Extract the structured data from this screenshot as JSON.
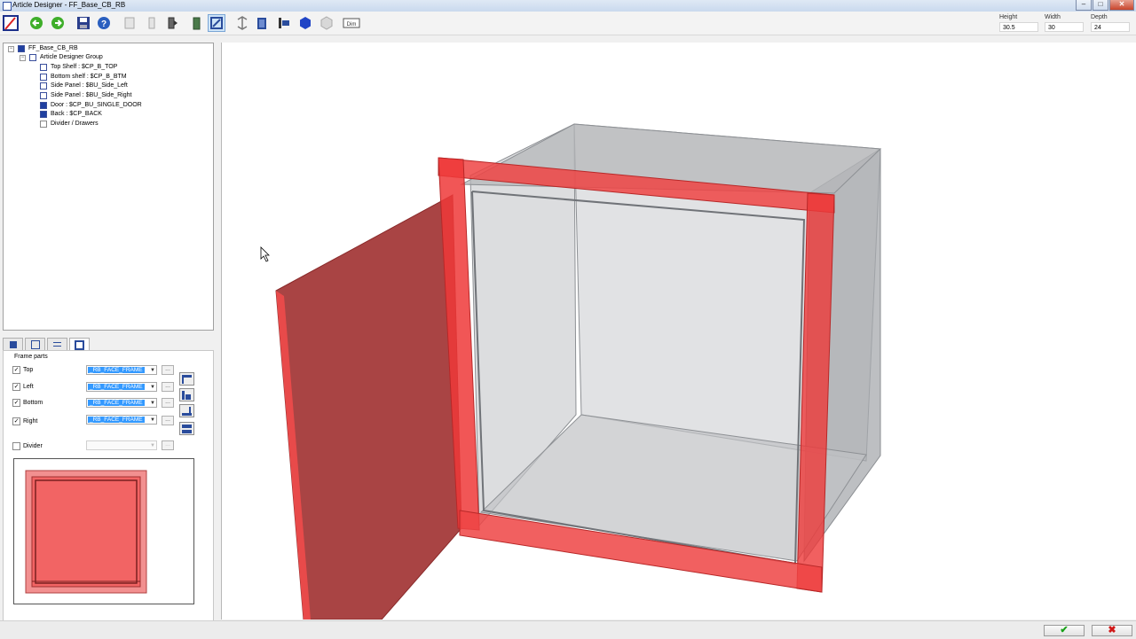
{
  "window": {
    "title": "Article Designer - FF_Base_CB_RB",
    "minimize": "–",
    "maximize": "□",
    "close": "✕"
  },
  "toolbar": {
    "icons": [
      "app-logo-icon",
      "back-arrow-icon",
      "forward-arrow-icon",
      "save-icon",
      "help-icon",
      "panel-a-icon",
      "panel-b-icon",
      "panel-c-icon",
      "green-panel-icon",
      "frame-select-icon",
      "split-icon",
      "door-icon",
      "align-icon",
      "hexagon-icon",
      "box-icon",
      "dimension-icon"
    ],
    "dim_label": "Dim"
  },
  "dimensions": {
    "height_label": "Height",
    "height_value": "30.5",
    "width_label": "Width",
    "width_value": "30",
    "depth_label": "Depth",
    "depth_value": "24"
  },
  "tree": {
    "root": "FF_Base_CB_RB",
    "group": "Article Designer Group",
    "items": [
      "Top Shelf : $CP_B_TOP",
      "Bottom shelf : $CP_B_BTM",
      "Side Panel : $BU_Side_Left",
      "Side Panel : $BU_Side_Right",
      "Door : $CP_BU_SINGLE_DOOR",
      "Back : $CP_BACK",
      "Divider / Drawers"
    ]
  },
  "props": {
    "group_label": "Frame parts",
    "rows": [
      {
        "label": "Top",
        "checked": true,
        "value": "_RB_FACE_FRAME"
      },
      {
        "label": "Left",
        "checked": true,
        "value": "_RB_FACE_FRAME"
      },
      {
        "label": "Bottom",
        "checked": true,
        "value": "_RB_FACE_FRAME"
      },
      {
        "label": "Right",
        "checked": true,
        "value": "_RB_FACE_FRAME"
      }
    ],
    "divider_label": "Divider",
    "divider_checked": false,
    "dots": "...",
    "check_mark": "✓"
  },
  "colors": {
    "frame_red": "#ee3333",
    "preview_fill": "#f26464",
    "cabinet_grey": "#9c9fa3",
    "accent": "#3399ff"
  },
  "footer": {
    "ok": "✔",
    "cancel": "✖"
  }
}
